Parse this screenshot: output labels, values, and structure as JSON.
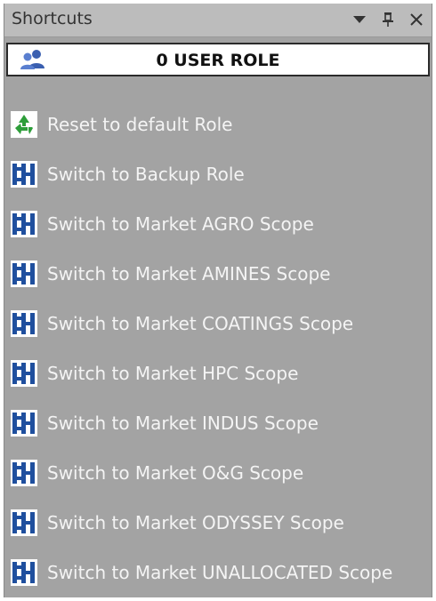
{
  "panel": {
    "title": "Shortcuts",
    "controls": {
      "dropdown_icon": "dropdown-arrow-icon",
      "pin_icon": "pin-icon",
      "close_icon": "close-icon"
    }
  },
  "role_bar": {
    "icon": "users-icon",
    "label": "0 USER ROLE"
  },
  "shortcuts": [
    {
      "label": "Reset to default Role",
      "icon": "recycle-icon"
    },
    {
      "label": "Switch to Backup Role",
      "icon": "switch-scope-icon"
    },
    {
      "label": "Switch to Market AGRO Scope",
      "icon": "switch-scope-icon"
    },
    {
      "label": "Switch to Market AMINES Scope",
      "icon": "switch-scope-icon"
    },
    {
      "label": "Switch to Market COATINGS Scope",
      "icon": "switch-scope-icon"
    },
    {
      "label": "Switch to Market HPC Scope",
      "icon": "switch-scope-icon"
    },
    {
      "label": "Switch to Market INDUS Scope",
      "icon": "switch-scope-icon"
    },
    {
      "label": "Switch to Market O&G Scope",
      "icon": "switch-scope-icon"
    },
    {
      "label": "Switch to Market ODYSSEY Scope",
      "icon": "switch-scope-icon"
    },
    {
      "label": "Switch to Market UNALLOCATED Scope",
      "icon": "switch-scope-icon"
    }
  ],
  "colors": {
    "panel_bg": "#a3a3a3",
    "titlebar_bg": "#bcbcbc",
    "item_text": "#f4f4f4",
    "icon_blue": "#1f4f9e",
    "icon_green": "#2e9e3a"
  }
}
